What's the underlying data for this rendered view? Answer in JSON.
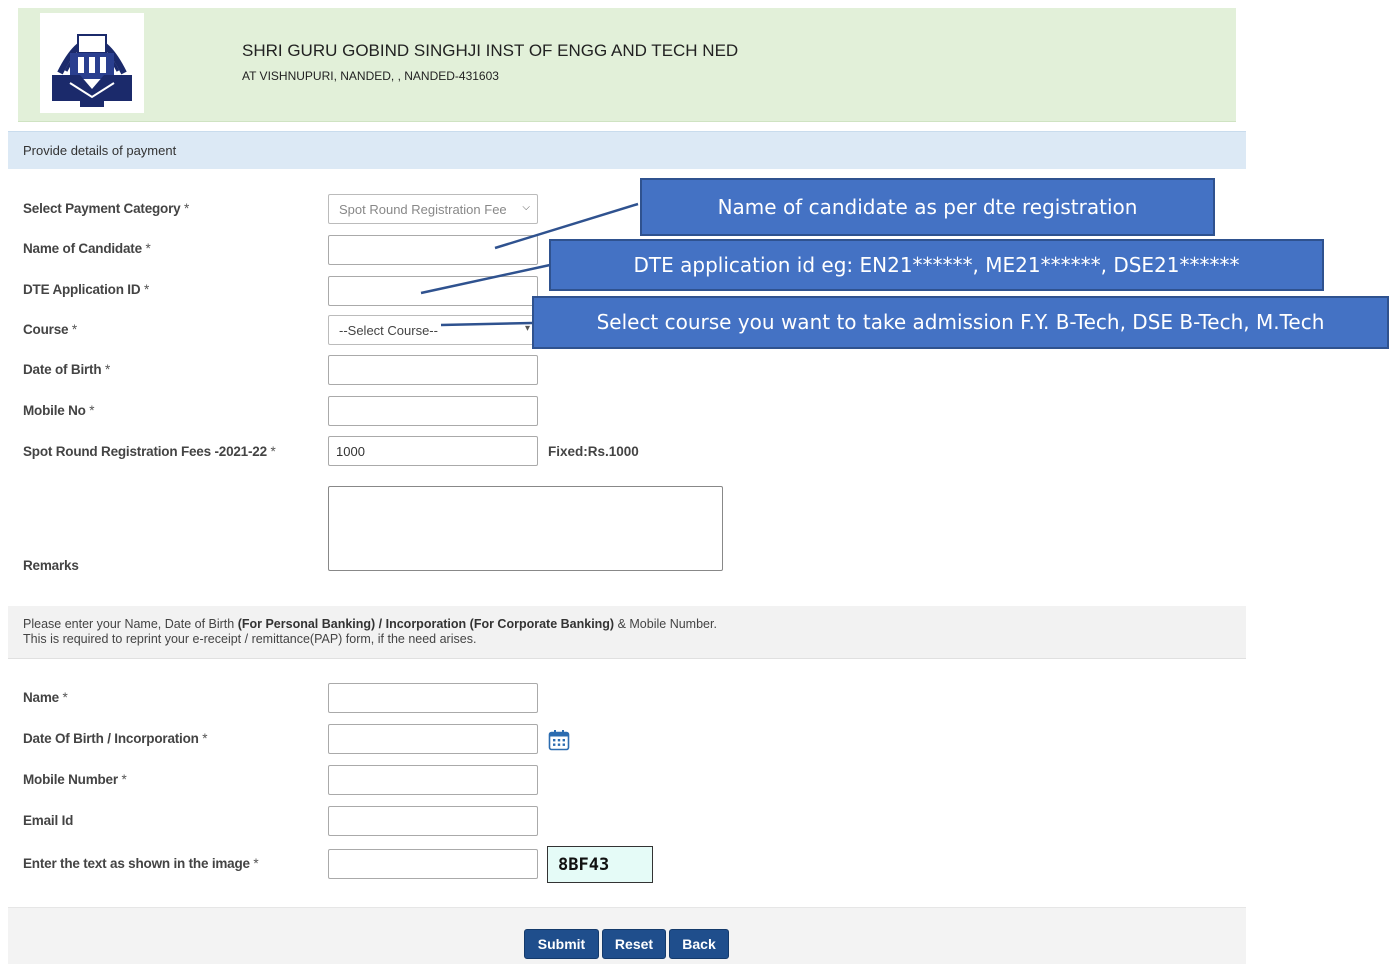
{
  "header": {
    "institute_name": "SHRI GURU GOBIND SINGHJI INST OF ENGG AND TECH NED",
    "institute_address": "AT VISHNUPURI, NANDED, , NANDED-431603",
    "logo_icon": "institute-emblem-logo"
  },
  "section": {
    "title": "Provide details of payment"
  },
  "form": {
    "payment_category": {
      "label": "Select Payment Category",
      "value": "Spot Round Registration Fee"
    },
    "candidate_name": {
      "label": "Name of Candidate",
      "value": ""
    },
    "dte_id": {
      "label": "DTE Application ID",
      "value": ""
    },
    "course": {
      "label": "Course",
      "value": "--Select Course--"
    },
    "dob": {
      "label": "Date of Birth",
      "value": ""
    },
    "mobile": {
      "label": "Mobile No",
      "value": ""
    },
    "fees": {
      "label": "Spot Round Registration Fees -2021-22",
      "value": "1000",
      "note": "Fixed:Rs.1000"
    },
    "remarks": {
      "label": "Remarks"
    },
    "required_mark": "*"
  },
  "notice": {
    "line1_a": "Please enter your Name, Date of Birth ",
    "line1_b": "(For Personal Banking) / Incorporation (For Corporate Banking)",
    "line1_c": " & Mobile Number.",
    "line2": "This is required to reprint your e-receipt / remittance(PAP) form, if the need arises."
  },
  "personal": {
    "name": {
      "label": "Name"
    },
    "dob_inc": {
      "label": "Date Of Birth / Incorporation"
    },
    "mobile": {
      "label": "Mobile Number"
    },
    "email": {
      "label": "Email Id"
    },
    "captcha": {
      "label": "Enter the text as shown in the image",
      "text": "8BF43"
    }
  },
  "buttons": {
    "submit": "Submit",
    "reset": "Reset",
    "back": "Back"
  },
  "callouts": {
    "name": "Name of candidate as per dte registration",
    "dte": "DTE application id eg: EN21******, ME21******, DSE21******",
    "course": "Select course you want to take admission  F.Y. B-Tech, DSE B-Tech, M.Tech"
  },
  "colors": {
    "header_bg": "#e2f0d9",
    "section_bg": "#dce9f5",
    "button": "#1f4e8c",
    "callout": "#4472c4"
  }
}
